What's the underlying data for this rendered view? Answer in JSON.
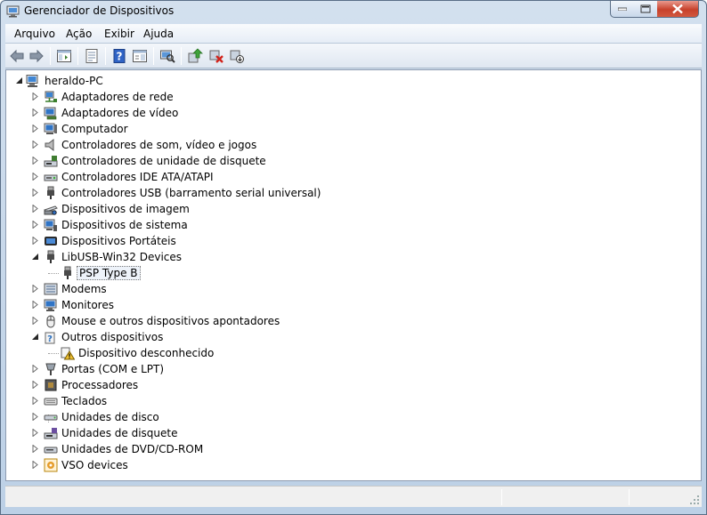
{
  "window": {
    "title": "Gerenciador de Dispositivos"
  },
  "menu": {
    "items": [
      "Arquivo",
      "Ação",
      "Exibir",
      "Ajuda"
    ]
  },
  "toolbar": {
    "buttons": [
      "back-arrow-icon",
      "forward-arrow-icon",
      "show-hide-console-tree-icon",
      "properties-icon",
      "help-icon",
      "action-pane-icon",
      "scan-hardware-icon",
      "update-driver-icon",
      "uninstall-icon",
      "disable-device-icon"
    ]
  },
  "tree": {
    "root": "heraldo-PC",
    "items": [
      "Adaptadores de rede",
      "Adaptadores de vídeo",
      "Computador",
      "Controladores de som, vídeo e jogos",
      "Controladores de unidade de disquete",
      "Controladores IDE ATA/ATAPI",
      "Controladores USB (barramento serial universal)",
      "Dispositivos de imagem",
      "Dispositivos de sistema",
      "Dispositivos Portáteis",
      "LibUSB-Win32 Devices",
      "PSP Type B",
      "Modems",
      "Monitores",
      "Mouse e outros dispositivos apontadores",
      "Outros dispositivos",
      "Dispositivo desconhecido",
      "Portas (COM e LPT)",
      "Processadores",
      "Teclados",
      "Unidades de disco",
      "Unidades de disquete",
      "Unidades de DVD/CD-ROM",
      "VSO devices"
    ]
  },
  "colors": {
    "accent": "#2a6ebd",
    "warning": "#f1c232"
  }
}
